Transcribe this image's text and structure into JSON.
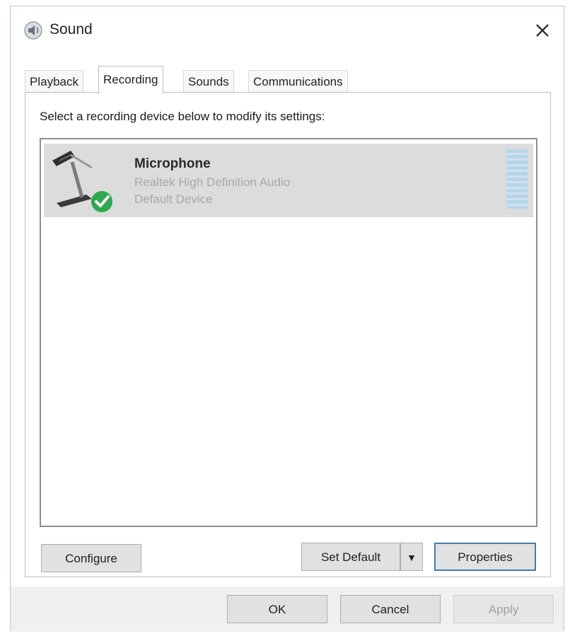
{
  "window": {
    "title": "Sound",
    "close_glyph": "✕",
    "icon": "speaker-icon"
  },
  "tabs": [
    {
      "label": "Playback",
      "active": false
    },
    {
      "label": "Recording",
      "active": true
    },
    {
      "label": "Sounds",
      "active": false
    },
    {
      "label": "Communications",
      "active": false
    }
  ],
  "panel": {
    "instruction": "Select a recording device below to modify its settings:"
  },
  "devices": [
    {
      "name": "Microphone",
      "description": "Realtek High Definition Audio",
      "status": "Default Device",
      "selected": true,
      "icon": "microphone-icon",
      "status_icon": "default-check-icon"
    }
  ],
  "buttons": {
    "configure": "Configure",
    "set_default": "Set Default",
    "set_default_arrow": "▼",
    "properties": "Properties",
    "ok": "OK",
    "cancel": "Cancel",
    "apply": "Apply"
  },
  "colors": {
    "selection": "#dcdcdc",
    "check_green": "#2fa84f",
    "focus_blue": "#3c7fb1"
  }
}
